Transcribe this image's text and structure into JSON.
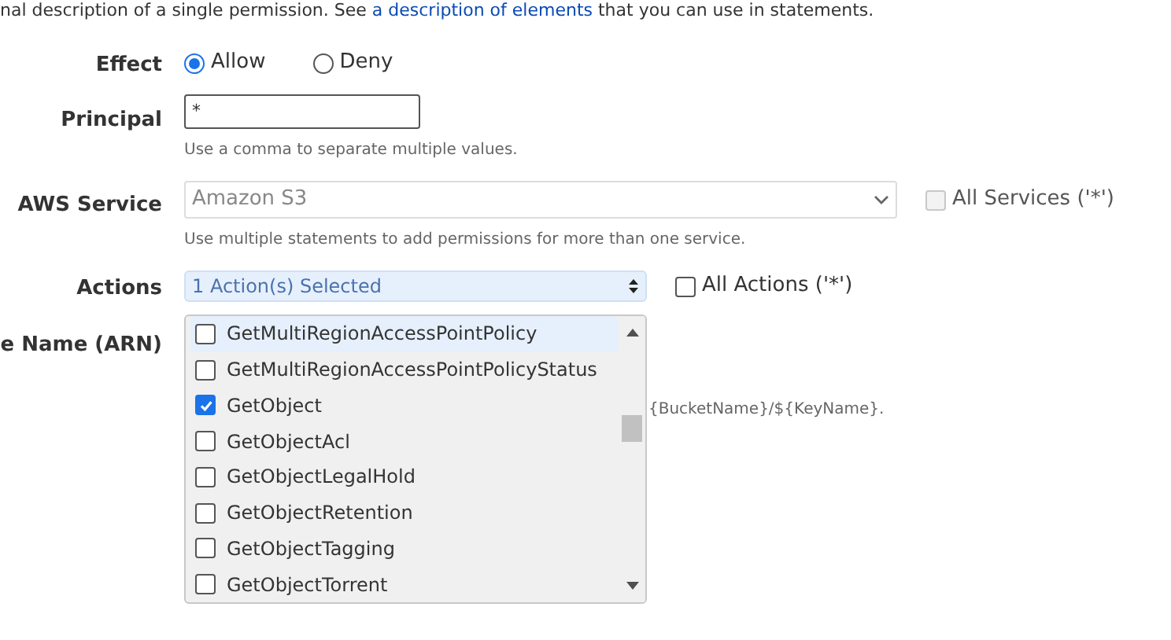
{
  "intro": {
    "before": "nal description of a single permission. See ",
    "link": "a description of elements",
    "after": " that you can use in statements."
  },
  "effect": {
    "label": "Effect",
    "options": [
      {
        "label": "Allow",
        "selected": true
      },
      {
        "label": "Deny",
        "selected": false
      }
    ]
  },
  "principal": {
    "label": "Principal",
    "value": "*",
    "hint": "Use a comma to separate multiple values."
  },
  "service": {
    "label": "AWS Service",
    "value": "Amazon S3",
    "disabled": true,
    "hint": "Use multiple statements to add permissions for more than one service.",
    "all": {
      "label": "All Services ('*')",
      "checked": false,
      "disabled": true
    }
  },
  "actions": {
    "label": "Actions",
    "value": "1 Action(s) Selected",
    "all": {
      "label": "All Actions ('*')",
      "checked": false
    },
    "items": [
      {
        "label": "GetMultiRegionAccessPointPolicy",
        "checked": false,
        "highlighted": true
      },
      {
        "label": "GetMultiRegionAccessPointPolicyStatus",
        "checked": false,
        "highlighted": false
      },
      {
        "label": "GetObject",
        "checked": true,
        "highlighted": false
      },
      {
        "label": "GetObjectAcl",
        "checked": false,
        "highlighted": false
      },
      {
        "label": "GetObjectLegalHold",
        "checked": false,
        "highlighted": false
      },
      {
        "label": "GetObjectRetention",
        "checked": false,
        "highlighted": false
      },
      {
        "label": "GetObjectTagging",
        "checked": false,
        "highlighted": false
      },
      {
        "label": "GetObjectTorrent",
        "checked": false,
        "highlighted": false
      }
    ]
  },
  "arn": {
    "label": "e Name (ARN)",
    "hint": "{BucketName}/${KeyName}."
  }
}
